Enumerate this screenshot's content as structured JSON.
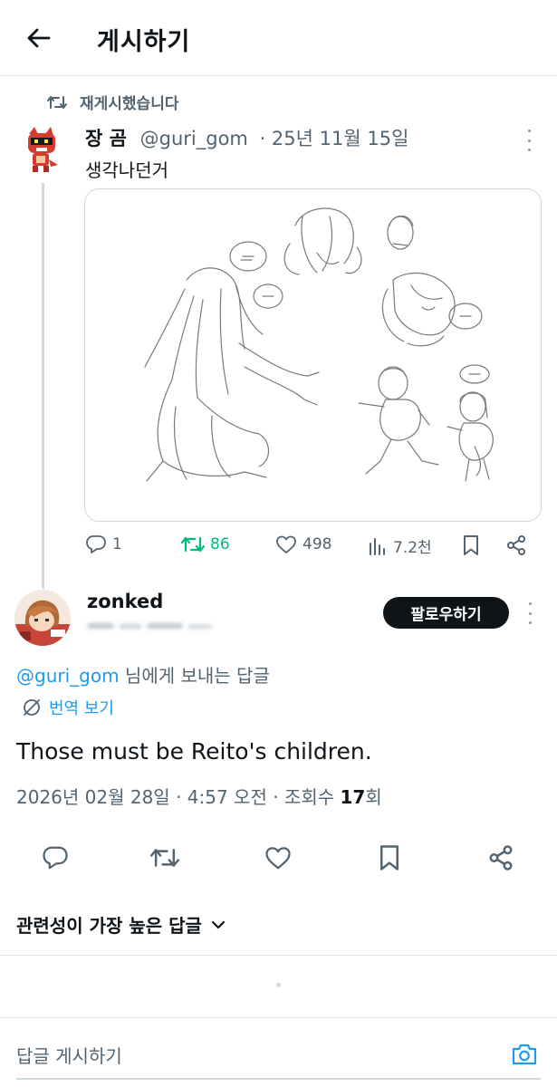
{
  "header": {
    "title": "게시하기",
    "back_icon": "arrow-left-icon"
  },
  "repost": {
    "label": "재게시했습니다",
    "icon": "repost-icon"
  },
  "tweet": {
    "display_name": "장 곰",
    "handle": "@guri_gom",
    "date": "· 25년 11월 15일",
    "text": "생각나던거",
    "image_alt": "sketch drawing",
    "stats": {
      "replies": "1",
      "reposts": "86",
      "likes": "498",
      "views": "7.2천"
    }
  },
  "reply": {
    "display_name": "zonked",
    "follow_label": "팔로우하기",
    "mention": "@guri_gom",
    "reply_to_suffix": " 님에게 보내는 답글",
    "translate_label": "번역 보기",
    "text": "Those must be Reito's children.",
    "meta_prefix": "2026년 02월 28일 · 4:57 오전 · 조회수 ",
    "views": "17",
    "meta_suffix": "회"
  },
  "sort": {
    "label": "관련성이 가장 높은 답글"
  },
  "compose": {
    "placeholder": "답글 게시하기"
  },
  "colors": {
    "accent": "#1d9bf0",
    "repost_green": "#00ba7c",
    "text": "#0f1419",
    "muted": "#536471"
  }
}
